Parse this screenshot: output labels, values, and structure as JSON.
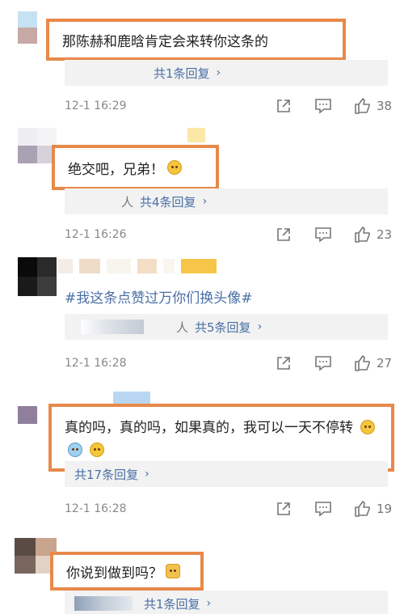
{
  "comments": [
    {
      "text": "那陈赫和鹿晗肯定会来转你这条的",
      "reply_link": "共1条回复",
      "timestamp": "12-1 16:29",
      "likes": "38"
    },
    {
      "text": "绝交吧，兄弟！",
      "reply_prefix": "人",
      "reply_link": "共4条回复",
      "timestamp": "12-1 16:26",
      "likes": "23"
    },
    {
      "text": "#我这条点赞过万你们换头像#",
      "reply_prefix": "人",
      "reply_link": "共5条回复",
      "timestamp": "12-1 16:28",
      "likes": "27"
    },
    {
      "text": "真的吗，真的吗，如果真的，我可以一天不停转",
      "reply_link": "共17条回复",
      "timestamp": "12-1 16:28",
      "likes": "19"
    },
    {
      "text": "你说到做到吗？",
      "reply_link": "共1条回复"
    }
  ],
  "icons": {
    "chevron": "chevron-right-icon",
    "share": "share-icon",
    "comment": "comment-icon",
    "like": "thumbs-up-icon"
  },
  "colors": {
    "highlight_border": "#e8894a",
    "link": "#4a6fa5",
    "meta": "#888888",
    "reply_bg": "#f2f2f2"
  }
}
